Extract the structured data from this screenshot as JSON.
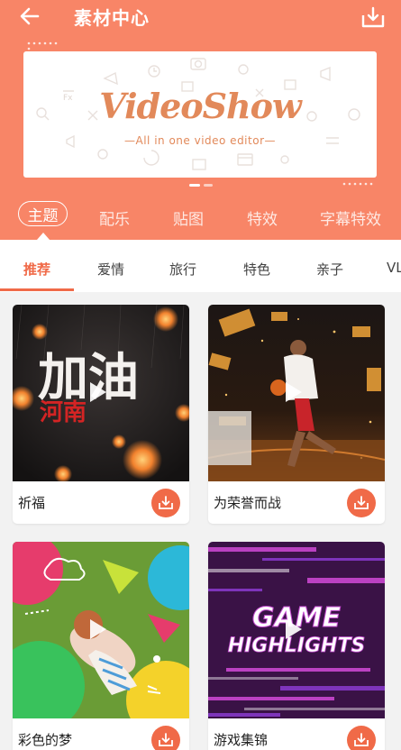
{
  "header": {
    "title": "素材中心",
    "back_icon": "arrow-left-icon",
    "download_icon": "download-tray-icon"
  },
  "banner": {
    "logo_text": "VideoShow",
    "tagline": "—All in one video editor—"
  },
  "category_tabs": [
    {
      "label": "主题",
      "active": true
    },
    {
      "label": "配乐",
      "active": false
    },
    {
      "label": "贴图",
      "active": false
    },
    {
      "label": "特效",
      "active": false
    },
    {
      "label": "字幕特效",
      "active": false
    }
  ],
  "sub_tabs": [
    {
      "label": "推荐",
      "active": true
    },
    {
      "label": "爱情",
      "active": false
    },
    {
      "label": "旅行",
      "active": false
    },
    {
      "label": "特色",
      "active": false
    },
    {
      "label": "亲子",
      "active": false
    },
    {
      "label": "VL",
      "active": false
    }
  ],
  "cards": [
    {
      "title": "祈福",
      "thumb_text_1": "加油",
      "thumb_text_2": "河南"
    },
    {
      "title": "为荣誉而战"
    },
    {
      "title": "彩色的梦"
    },
    {
      "title": "游戏集锦",
      "thumb_text_1": "GAME",
      "thumb_text_2": "HIGHLIGHTS"
    }
  ],
  "colors": {
    "header_bg": "#f88567",
    "accent": "#f06a48",
    "logo": "#e2895a"
  }
}
